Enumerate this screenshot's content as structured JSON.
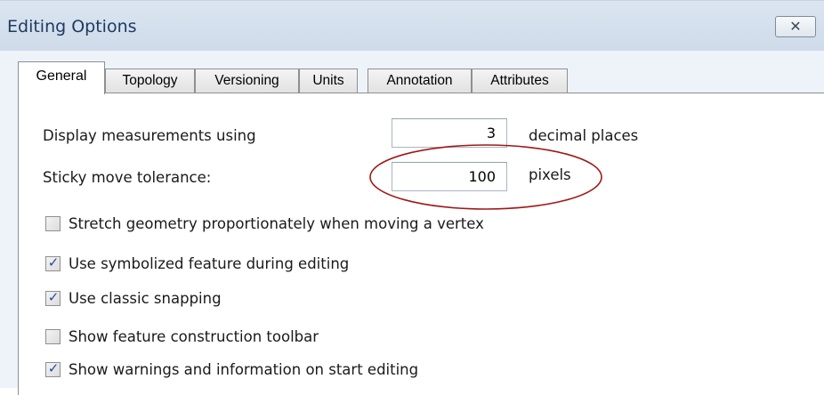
{
  "window": {
    "title": "Editing Options",
    "close_glyph": "✕"
  },
  "tabs": [
    {
      "label": "General",
      "active": true
    },
    {
      "label": "Topology",
      "active": false
    },
    {
      "label": "Versioning",
      "active": false
    },
    {
      "label": "Units",
      "active": false
    },
    {
      "label": "Annotation",
      "active": false
    },
    {
      "label": "Attributes",
      "active": false
    }
  ],
  "general": {
    "measurements": {
      "label": "Display measurements using",
      "value": "3",
      "suffix": "decimal places"
    },
    "sticky": {
      "label": "Sticky move tolerance:",
      "value": "100",
      "suffix": "pixels"
    },
    "options": [
      {
        "label": "Stretch geometry proportionately when moving a vertex",
        "checked": false
      },
      {
        "label": "Use symbolized feature during editing",
        "checked": true
      },
      {
        "label": "Use classic snapping",
        "checked": true
      },
      {
        "label": "Show feature construction toolbar",
        "checked": false
      },
      {
        "label": "Show warnings and information on start editing",
        "checked": true
      }
    ]
  },
  "colors": {
    "annotation_ellipse": "#a01818",
    "checkmark": "#2a4aa0"
  }
}
